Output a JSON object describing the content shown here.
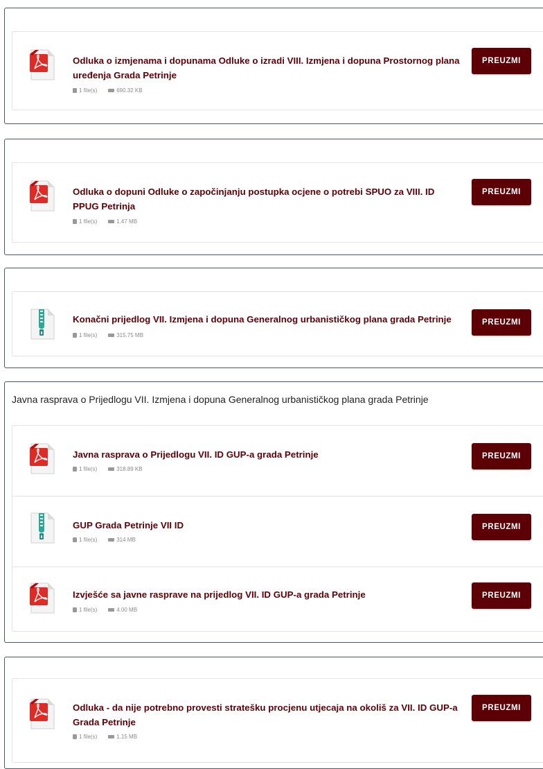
{
  "button_label": "PREUZMI",
  "colors": {
    "accent": "#5e0008",
    "button_bg": "#5c0006",
    "border": "#4a5566"
  },
  "groups": [
    {
      "title": "",
      "docs": [
        {
          "icon": "pdf-file-icon",
          "title": "Odluka o izmjenama i dopunama Odluke o izradi VIII. Izmjena i dopuna Prostornog plana uređenja Grada Petrinje",
          "files": "1 file(s)",
          "size": "690.32 KB"
        }
      ]
    },
    {
      "title": "",
      "docs": [
        {
          "icon": "pdf-file-icon",
          "title": "Odluka o dopuni Odluke o započinjanju postupka ocjene o potrebi SPUO za VIII. ID PPUG Petrinja",
          "files": "1 file(s)",
          "size": "1.47 MB"
        }
      ]
    },
    {
      "title": "",
      "docs": [
        {
          "icon": "zip-file-icon",
          "title": "Konačni prijedlog VII. Izmjena i dopuna Generalnog urbanističkog plana grada Petrinje",
          "files": "1 file(s)",
          "size": "315.75 MB"
        }
      ]
    },
    {
      "title": "Javna rasprava o Prijedlogu VII. Izmjena i dopuna Generalnog urbanističkog plana grada Petrinje",
      "docs": [
        {
          "icon": "pdf-file-icon",
          "title": "Javna rasprava o Prijedlogu VII. ID GUP-a grada Petrinje",
          "files": "1 file(s)",
          "size": "318.89 KB"
        },
        {
          "icon": "zip-file-icon",
          "title": "GUP Grada Petrinje VII ID",
          "files": "1 file(s)",
          "size": "314 MB"
        },
        {
          "icon": "pdf-file-icon",
          "title": "Izvješće sa javne rasprave na prijedlog VII. ID GUP-a grada Petrinje",
          "files": "1 file(s)",
          "size": "4.00 MB"
        }
      ]
    },
    {
      "title": "",
      "docs": [
        {
          "icon": "pdf-file-icon",
          "title": "Odluka - da nije potrebno provesti stratešku procjenu utjecaja na okoliš za VII. ID GUP-a Grada Petrinje",
          "files": "1 file(s)",
          "size": "1.15 MB"
        }
      ]
    }
  ]
}
